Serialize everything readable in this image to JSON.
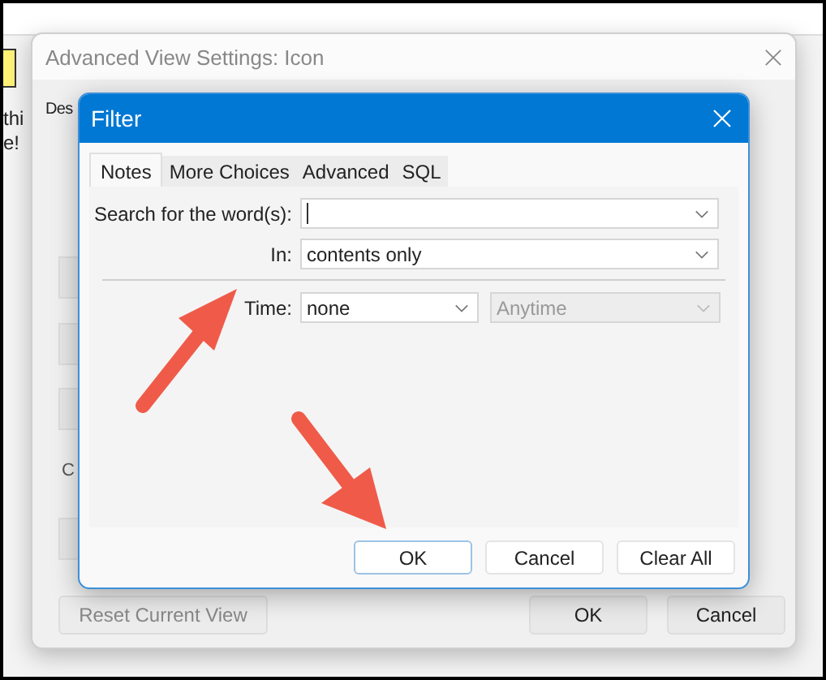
{
  "background": {
    "texts": [
      "thi",
      "e!"
    ]
  },
  "outer_dialog": {
    "title": "Advanced View Settings: Icon",
    "section_label": "Des",
    "row_label": "C",
    "buttons": [
      {
        "label": "Reset Current View",
        "disabled": true
      },
      {
        "label": "OK",
        "disabled": false
      },
      {
        "label": "Cancel",
        "disabled": false
      }
    ]
  },
  "filter_dialog": {
    "title": "Filter",
    "tabs": [
      {
        "label": "Notes",
        "selected": true
      },
      {
        "label": "More Choices",
        "selected": false
      },
      {
        "label": "Advanced",
        "selected": false
      },
      {
        "label": "SQL",
        "selected": false
      }
    ],
    "search": {
      "label": "Search for the word(s):"
    },
    "in": {
      "label": "In:",
      "value": "contents only"
    },
    "time": {
      "label": "Time:",
      "combos": [
        {
          "value": "none",
          "disabled": false
        },
        {
          "value": "Anytime",
          "disabled": true
        }
      ]
    },
    "buttons": [
      {
        "label": "OK",
        "default": true
      },
      {
        "label": "Cancel",
        "default": false
      },
      {
        "label": "Clear All",
        "default": false
      }
    ]
  }
}
